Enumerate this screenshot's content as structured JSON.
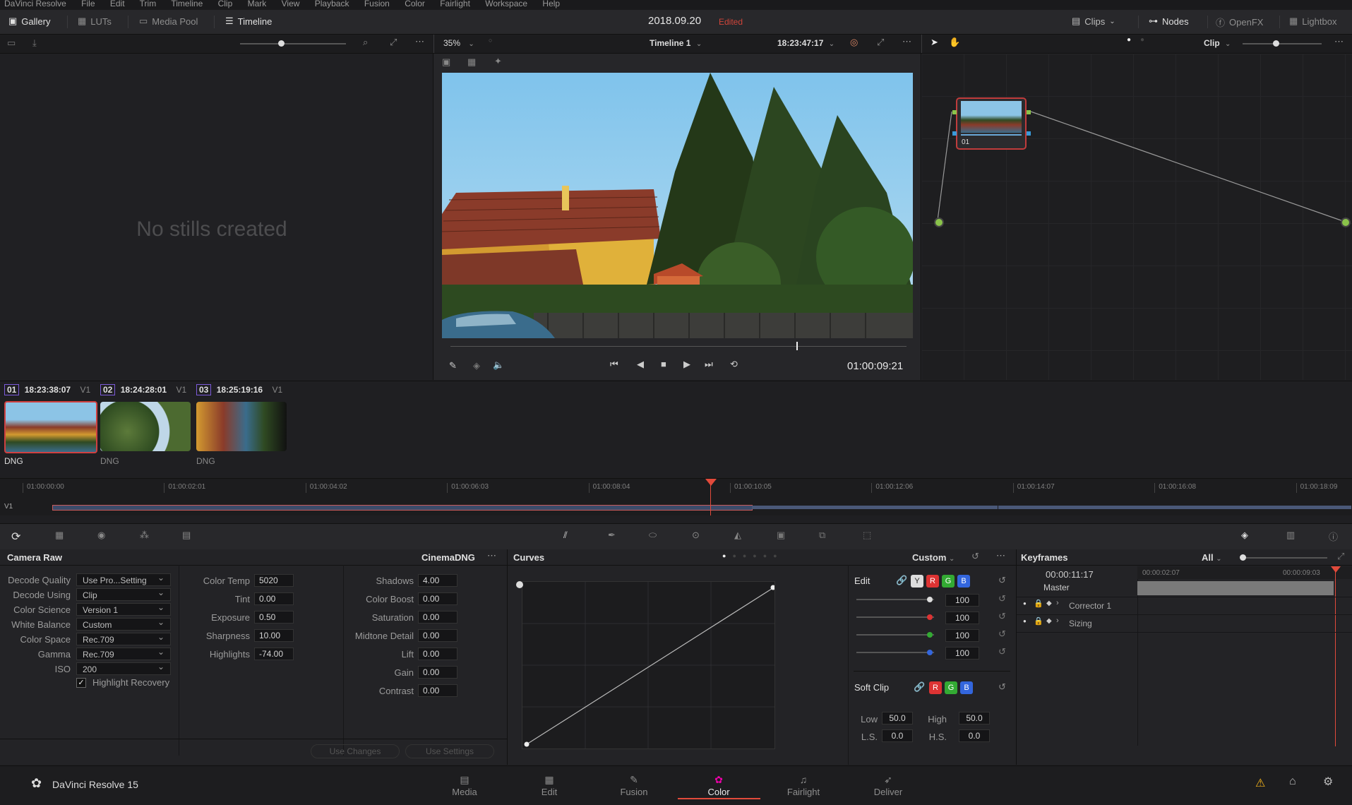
{
  "menu": [
    "DaVinci Resolve",
    "File",
    "Edit",
    "Trim",
    "Timeline",
    "Clip",
    "Mark",
    "View",
    "Playback",
    "Fusion",
    "Color",
    "Fairlight",
    "Workspace",
    "Help"
  ],
  "toolbar": {
    "gallery": "Gallery",
    "luts": "LUTs",
    "media_pool": "Media Pool",
    "timeline": "Timeline",
    "project_date": "2018.09.20",
    "edited": "Edited",
    "clips": "Clips",
    "nodes": "Nodes",
    "openfx": "OpenFX",
    "lightbox": "Lightbox"
  },
  "viewer": {
    "zoom": "35%",
    "timeline_name": "Timeline 1",
    "timecode": "18:23:47:17",
    "playhead_tc": "01:00:09:21",
    "mode": "Clip"
  },
  "gallery": {
    "empty": "No stills created"
  },
  "nodes": {
    "node_label": "01"
  },
  "clips": [
    {
      "num": "01",
      "tc": "18:23:38:07",
      "track": "V1",
      "codec": "DNG"
    },
    {
      "num": "02",
      "tc": "18:24:28:01",
      "track": "V1",
      "codec": "DNG"
    },
    {
      "num": "03",
      "tc": "18:25:19:16",
      "track": "V1",
      "codec": "DNG"
    }
  ],
  "timeline": {
    "ruler": [
      "01:00:00:00",
      "01:00:02:01",
      "01:00:04:02",
      "01:00:06:03",
      "01:00:08:04",
      "01:00:10:05",
      "01:00:12:06",
      "01:00:14:07",
      "01:00:16:08",
      "01:00:18:09"
    ],
    "track": "V1"
  },
  "camera_raw": {
    "title": "Camera Raw",
    "format": "CinemaDNG",
    "decode_quality_label": "Decode Quality",
    "decode_quality": "Use Pro...Setting",
    "decode_using_label": "Decode Using",
    "decode_using": "Clip",
    "color_science_label": "Color Science",
    "color_science": "Version 1",
    "white_balance_label": "White Balance",
    "white_balance": "Custom",
    "color_space_label": "Color Space",
    "color_space": "Rec.709",
    "gamma_label": "Gamma",
    "gamma": "Rec.709",
    "iso_label": "ISO",
    "iso": "200",
    "highlight_recovery": "Highlight Recovery",
    "color_temp_label": "Color Temp",
    "color_temp": "5020",
    "tint_label": "Tint",
    "tint": "0.00",
    "exposure_label": "Exposure",
    "exposure": "0.50",
    "sharpness_label": "Sharpness",
    "sharpness": "10.00",
    "highlights_label": "Highlights",
    "highlights": "-74.00",
    "shadows_label": "Shadows",
    "shadows": "4.00",
    "color_boost_label": "Color Boost",
    "color_boost": "0.00",
    "saturation_label": "Saturation",
    "saturation": "0.00",
    "midtone_detail_label": "Midtone Detail",
    "midtone_detail": "0.00",
    "lift_label": "Lift",
    "lift": "0.00",
    "gain_label": "Gain",
    "gain": "0.00",
    "contrast_label": "Contrast",
    "contrast": "0.00",
    "use_changes": "Use Changes",
    "use_settings": "Use Settings"
  },
  "curves": {
    "title": "Curves",
    "mode": "Custom",
    "edit": "Edit",
    "y": "Y",
    "r": "R",
    "g": "G",
    "b": "B",
    "val_y": "100",
    "val_r": "100",
    "val_g": "100",
    "val_b": "100",
    "soft_clip": "Soft Clip",
    "low_label": "Low",
    "low": "50.0",
    "high_label": "High",
    "high": "50.0",
    "ls_label": "L.S.",
    "ls": "0.0",
    "hs_label": "H.S.",
    "hs": "0.0"
  },
  "keyframes": {
    "title": "Keyframes",
    "filter": "All",
    "tc": "00:00:11:17",
    "tc1": "00:00:02:07",
    "tc2": "00:00:09:03",
    "rows": [
      "Master",
      "Corrector 1",
      "Sizing"
    ]
  },
  "pages": {
    "app_name": "DaVinci Resolve 15",
    "tabs": [
      "Media",
      "Edit",
      "Fusion",
      "Color",
      "Fairlight",
      "Deliver"
    ],
    "active": "Color"
  },
  "colors": {
    "accent": "#e24a3b",
    "highlight": "#c85a5a",
    "bg": "#1f1f22"
  }
}
